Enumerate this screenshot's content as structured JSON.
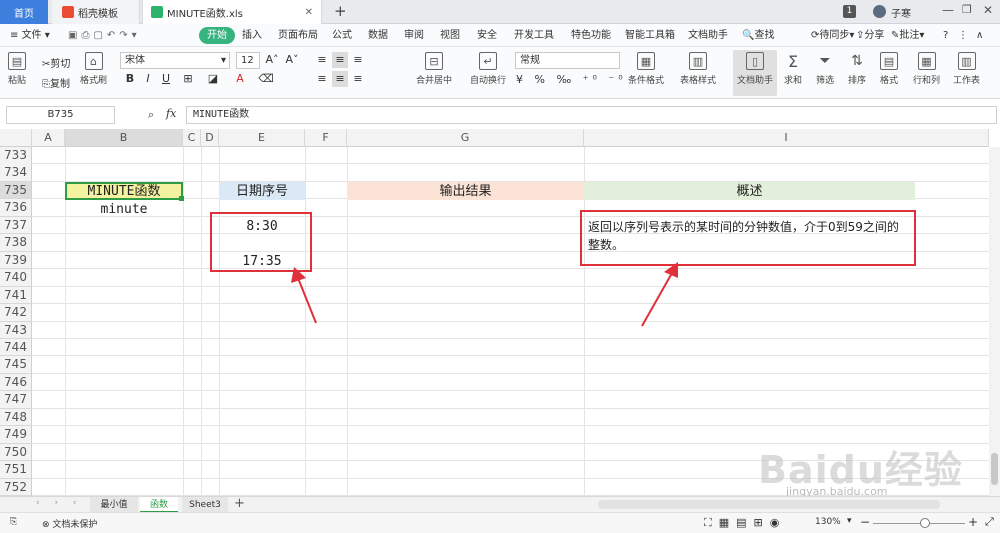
{
  "tabs": {
    "home": "首页",
    "template": "稻壳模板",
    "file": "MINUTE函数.xls",
    "page_badge": "1",
    "user": "子寒"
  },
  "menu": {
    "file": "文件",
    "start": "开始",
    "items": [
      "插入",
      "页面布局",
      "公式",
      "数据",
      "审阅",
      "视图",
      "安全",
      "开发工具",
      "特色功能",
      "智能工具箱",
      "文档助手"
    ],
    "search": "查找",
    "sync": "待同步",
    "share": "分享",
    "annotate": "批注"
  },
  "ribbon": {
    "paste": "粘贴",
    "cut": "剪切",
    "copy": "复制",
    "format_painter": "格式刷",
    "font_name": "宋体",
    "font_size": "12",
    "merge": "合并居中",
    "wrap": "自动换行",
    "number_format": "常规",
    "cond_format": "条件格式",
    "table_style": "表格样式",
    "doc_assist": "文档助手",
    "sum": "求和",
    "filter": "筛选",
    "sort": "排序",
    "format": "格式",
    "rowcol": "行和列",
    "worksheet": "工作表"
  },
  "formula_bar": {
    "cell_ref": "B735",
    "fx": "fx",
    "content": "MINUTE函数"
  },
  "columns": [
    "A",
    "B",
    "C",
    "D",
    "E",
    "F",
    "G",
    "I"
  ],
  "rows": [
    "733",
    "734",
    "735",
    "736",
    "737",
    "738",
    "739",
    "740",
    "741",
    "742",
    "743",
    "744",
    "745",
    "746",
    "747",
    "748",
    "749",
    "750",
    "751",
    "752"
  ],
  "cells": {
    "b735": "MINUTE函数",
    "b736": "minute",
    "e735": "日期序号",
    "e737": "8:30",
    "e739": "17:35",
    "g735": "输出结果",
    "i735": "概述",
    "i737": "返回以序列号表示的某时间的分钟数值，介于0到59之间的整数。"
  },
  "sheets": [
    "最小值",
    "函数",
    "Sheet3"
  ],
  "status": {
    "protect": "文档未保护",
    "zoom": "130%"
  },
  "watermark": "Baidu经验",
  "watermark_url": "jingyan.baidu.com",
  "colors": {
    "accent_green": "#36b37e",
    "header_yellow": "#f2f2a0",
    "header_blue": "#dbe9f7",
    "header_orange": "#fbe3d6",
    "header_green": "#e2efda",
    "annotation_red": "#e0303a"
  }
}
